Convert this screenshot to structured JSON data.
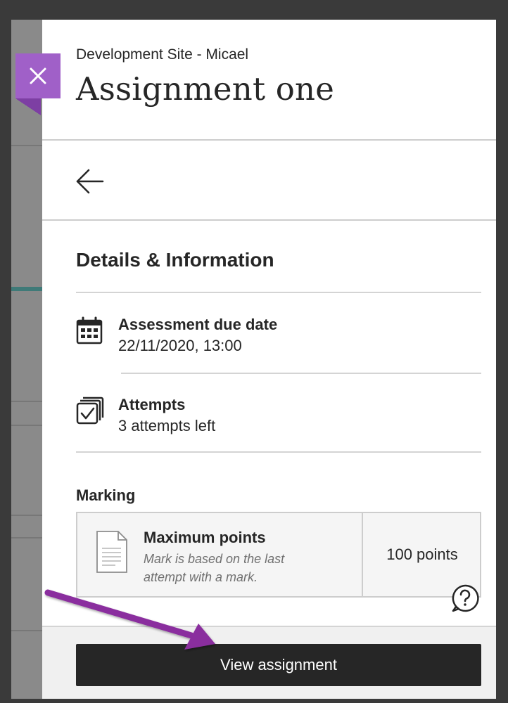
{
  "header": {
    "site_name": "Development Site - Micael",
    "title": "Assignment one"
  },
  "nav": {
    "back_icon": "arrow-left-icon",
    "close_icon": "close-icon"
  },
  "details": {
    "section_title": "Details & Information",
    "due_date": {
      "icon": "calendar-icon",
      "label": "Assessment due date",
      "value": "22/11/2020, 13:00"
    },
    "attempts": {
      "icon": "attempts-checkbox-icon",
      "label": "Attempts",
      "value": "3 attempts left"
    }
  },
  "marking": {
    "label": "Marking",
    "icon": "document-icon",
    "max_label": "Maximum points",
    "note": "Mark is based on the last attempt with a mark.",
    "points": "100 points"
  },
  "help": {
    "icon": "help-question-icon"
  },
  "footer": {
    "view_button_label": "View assignment"
  },
  "annotation": {
    "icon": "purple-arrow-icon"
  },
  "colors": {
    "close_button": "#a060c8",
    "close_fold": "#7d3fa3",
    "primary_button": "#262626",
    "annotation_arrow": "#8a2f9e"
  }
}
